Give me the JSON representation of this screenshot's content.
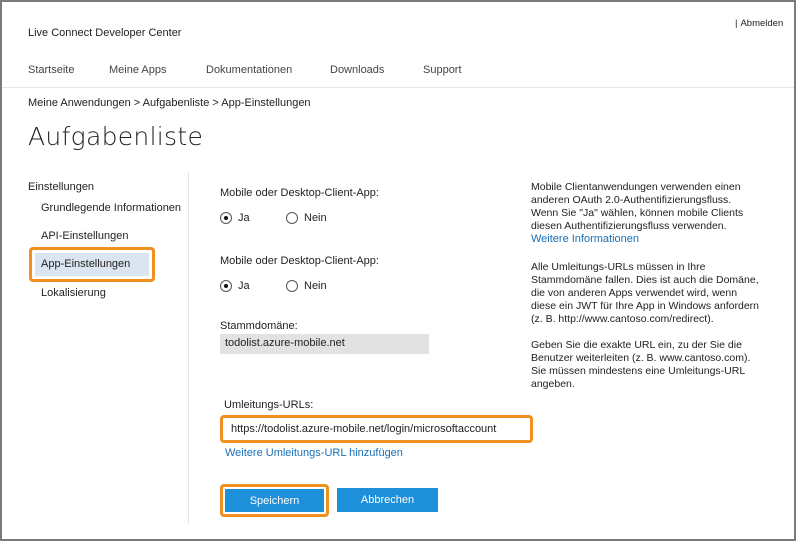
{
  "header": {
    "site_title": "Live Connect Developer Center",
    "signout_separator": "|",
    "signout_label": "Abmelden"
  },
  "nav": {
    "items": [
      {
        "label": "Startseite"
      },
      {
        "label": "Meine Apps"
      },
      {
        "label": "Dokumentationen"
      },
      {
        "label": "Downloads"
      },
      {
        "label": "Support"
      }
    ]
  },
  "breadcrumb": {
    "text": "Meine Anwendungen > Aufgabenliste > App-Einstellungen"
  },
  "page": {
    "title": "Aufgabenliste"
  },
  "sidebar": {
    "heading": "Einstellungen",
    "items": [
      {
        "label": "Grundlegende Informationen"
      },
      {
        "label": "API-Einstellungen"
      },
      {
        "label": "App-Einstellungen"
      },
      {
        "label": "Lokalisierung"
      }
    ]
  },
  "form": {
    "mobile1": {
      "label": "Mobile oder Desktop-Client-App:",
      "yes": "Ja",
      "no": "Nein",
      "selected": "Ja"
    },
    "mobile2": {
      "label": "Mobile oder Desktop-Client-App:",
      "yes": "Ja",
      "no": "Nein",
      "selected": "Ja"
    },
    "domain": {
      "label": "Stammdomäne:",
      "value": "todolist.azure-mobile.net"
    },
    "redirect": {
      "label": "Umleitungs-URLs:",
      "value": "https://todolist.azure-mobile.net/login/microsoftaccount",
      "add_link": "Weitere Umleitungs-URL hinzufügen"
    },
    "save_label": "Speichern",
    "cancel_label": "Abbrechen"
  },
  "help": {
    "p1_lines": [
      "Mobile Clientanwendungen verwenden einen",
      "anderen OAuth 2.0-Authentifizierungsfluss.",
      "Wenn Sie \"Ja\" wählen, können mobile Clients",
      "diesen Authentifizierungsfluss verwenden."
    ],
    "p1_link": "Weitere Informationen",
    "p2_lines": [
      "Alle Umleitungs-URLs müssen in Ihre",
      "Stammdomäne fallen. Dies ist auch die Domäne,",
      "die von anderen Apps verwendet wird, wenn",
      "diese ein JWT für Ihre App in Windows anfordern",
      "(z. B. http://www.cantoso.com/redirect)."
    ],
    "p3_lines": [
      "Geben Sie die exakte URL ein, zu der Sie die",
      "Benutzer weiterleiten (z. B. www.cantoso.com).",
      "Sie müssen mindestens eine Umleitungs-URL",
      "angeben."
    ]
  },
  "colors": {
    "accent_button": "#1e8fd9",
    "highlight_orange": "#f0901e",
    "link": "#1a6fb5",
    "selected_bg": "#dbe4f1"
  }
}
